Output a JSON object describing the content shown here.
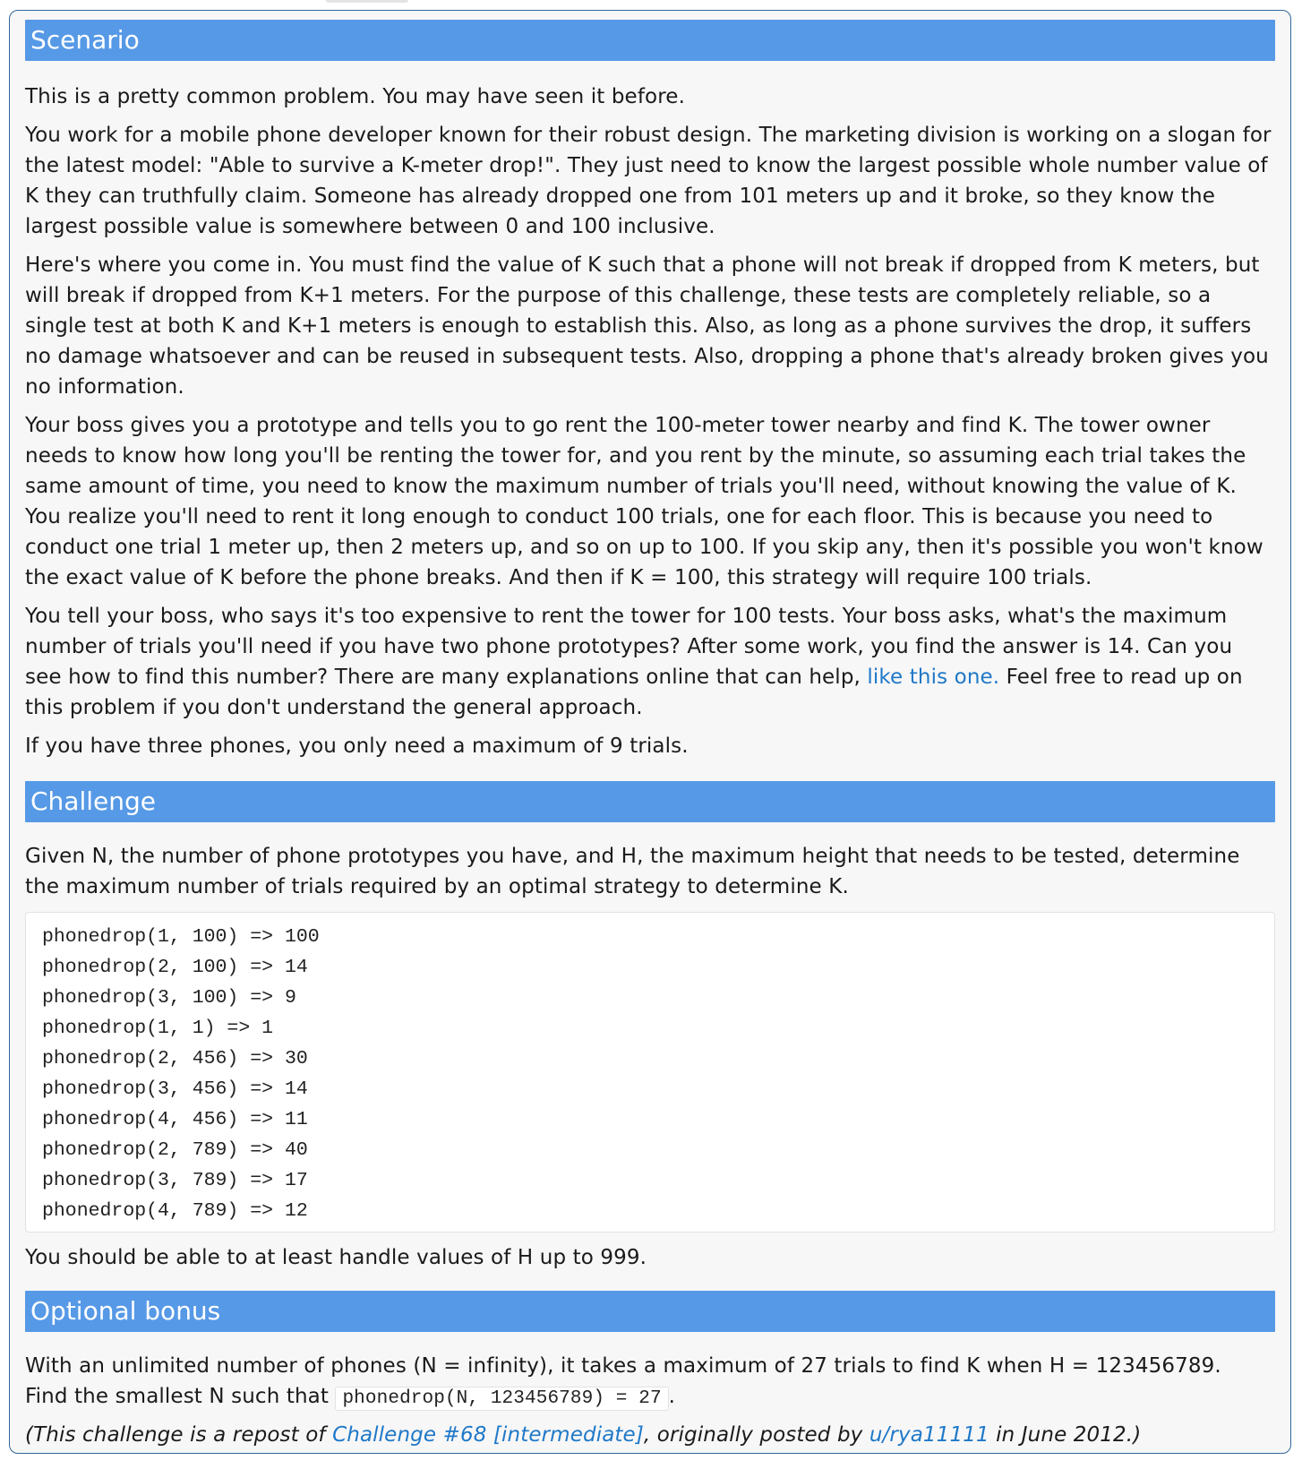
{
  "scenario": {
    "heading": "Scenario",
    "p1": "This is a pretty common problem. You may have seen it before.",
    "p2": "You work for a mobile phone developer known for their robust design. The marketing division is working on a slogan for the latest model: \"Able to survive a K-meter drop!\". They just need to know the largest possible whole number value of K they can truthfully claim. Someone has already dropped one from 101 meters up and it broke, so they know the largest possible value is somewhere between 0 and 100 inclusive.",
    "p3": "Here's where you come in. You must find the value of K such that a phone will not break if dropped from K meters, but will break if dropped from K+1 meters. For the purpose of this challenge, these tests are completely reliable, so a single test at both K and K+1 meters is enough to establish this. Also, as long as a phone survives the drop, it suffers no damage whatsoever and can be reused in subsequent tests. Also, dropping a phone that's already broken gives you no information.",
    "p4": "Your boss gives you a prototype and tells you to go rent the 100-meter tower nearby and find K. The tower owner needs to know how long you'll be renting the tower for, and you rent by the minute, so assuming each trial takes the same amount of time, you need to know the maximum number of trials you'll need, without knowing the value of K. You realize you'll need to rent it long enough to conduct 100 trials, one for each floor. This is because you need to conduct one trial 1 meter up, then 2 meters up, and so on up to 100. If you skip any, then it's possible you won't know the exact value of K before the phone breaks. And then if K = 100, this strategy will require 100 trials.",
    "p5_before": "You tell your boss, who says it's too expensive to rent the tower for 100 tests. Your boss asks, what's the maximum number of trials you'll need if you have two phone prototypes? After some work, you find the answer is 14. Can you see how to find this number? There are many explanations online that can help, ",
    "p5_link": "like this one.",
    "p5_after": " Feel free to read up on this problem if you don't understand the general approach.",
    "p6": "If you have three phones, you only need a maximum of 9 trials."
  },
  "challenge": {
    "heading": "Challenge",
    "intro": "Given N, the number of phone prototypes you have, and H, the maximum height that needs to be tested, determine the maximum number of trials required by an optimal strategy to determine K.",
    "examples": [
      "phonedrop(1, 100) => 100",
      "phonedrop(2, 100) => 14",
      "phonedrop(3, 100) => 9",
      "phonedrop(1, 1) => 1",
      "phonedrop(2, 456) => 30",
      "phonedrop(3, 456) => 14",
      "phonedrop(4, 456) => 11",
      "phonedrop(2, 789) => 40",
      "phonedrop(3, 789) => 17",
      "phonedrop(4, 789) => 12"
    ],
    "outro": "You should be able to at least handle values of H up to 999."
  },
  "bonus": {
    "heading": "Optional bonus",
    "p1": "With an unlimited number of phones (N = infinity), it takes a maximum of 27 trials to find K when H = 123456789.",
    "p2_before": "Find the smallest N such that ",
    "p2_code": "phonedrop(N, 123456789) = 27",
    "p2_after": ".",
    "note_open": "(This challenge is a repost of ",
    "note_link1": "Challenge #68 [intermediate]",
    "note_mid": ", originally posted by ",
    "note_link2": "u/rya11111",
    "note_close": " in June 2012.)"
  }
}
